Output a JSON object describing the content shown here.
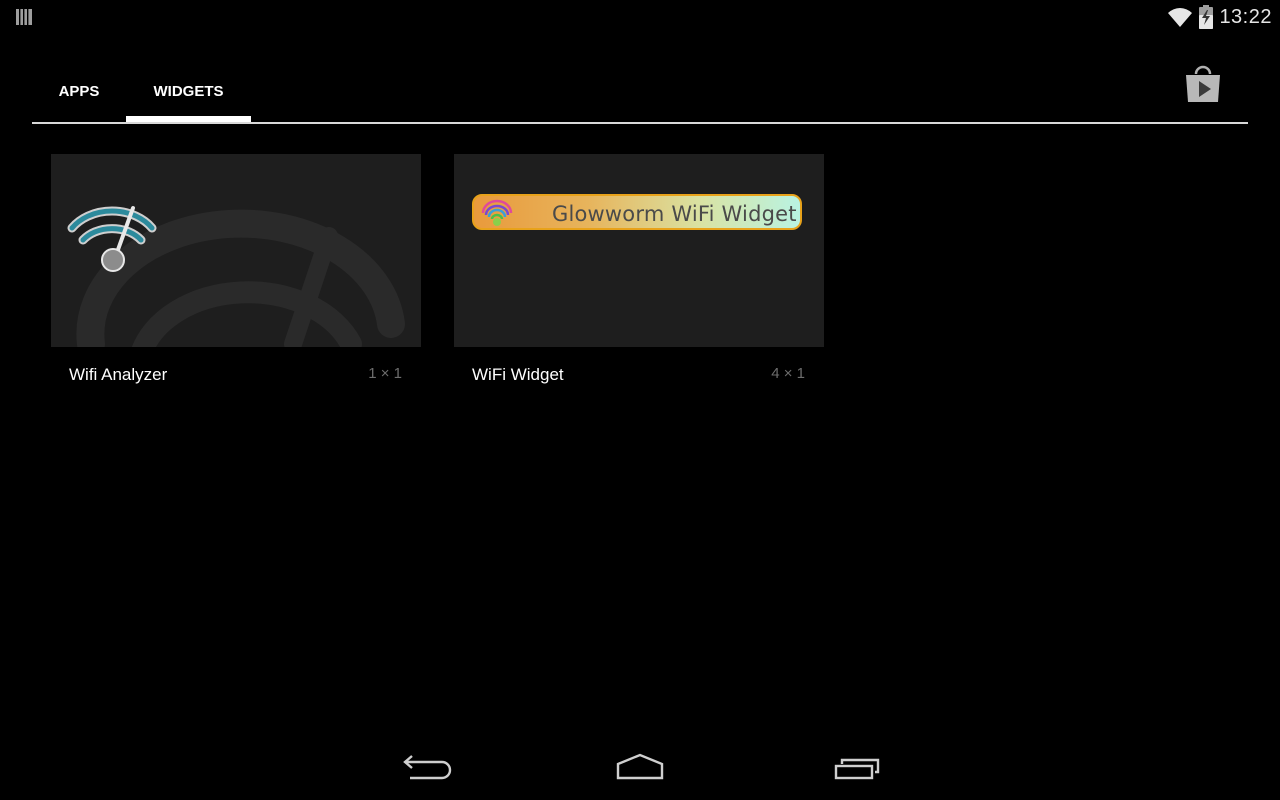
{
  "status_bar": {
    "time": "13:22",
    "icons": [
      "notification-icon",
      "wifi-icon",
      "battery-charging-icon"
    ]
  },
  "tabs": [
    {
      "label": "APPS",
      "selected": false
    },
    {
      "label": "WIDGETS",
      "selected": true
    }
  ],
  "store_button": {
    "icon": "play-store-icon"
  },
  "widgets": [
    {
      "name": "Wifi Analyzer",
      "size": "1 × 1",
      "icon": "wifi-analyzer-icon"
    },
    {
      "name": "WiFi Widget",
      "size": "4 × 1",
      "preview_text": "Glowworm WiFi Widget",
      "icon": "glowworm-wifi-icon"
    }
  ],
  "nav_bar": {
    "icons": [
      "back-icon",
      "home-icon",
      "recents-icon"
    ]
  },
  "colors": {
    "background": "#000000",
    "card": "#1e1e1e",
    "glow_border": "#e8a21a",
    "size_text": "#6d6d6d"
  }
}
